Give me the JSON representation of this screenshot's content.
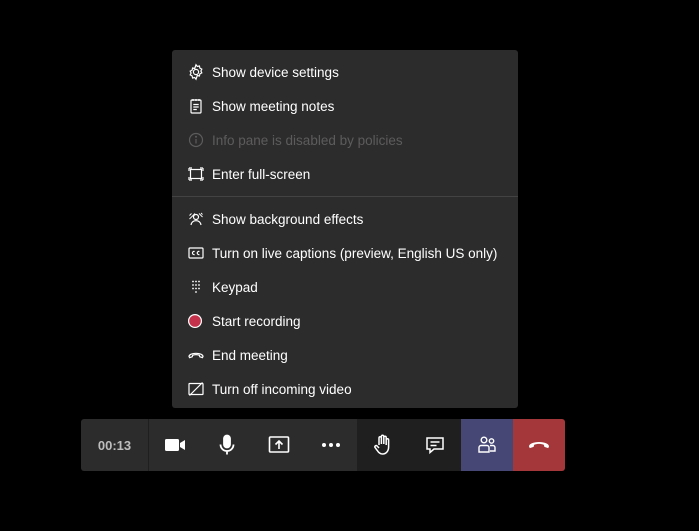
{
  "menu": {
    "items": [
      {
        "label": "Show device settings",
        "icon": "gear-icon",
        "disabled": false
      },
      {
        "label": "Show meeting notes",
        "icon": "notes-icon",
        "disabled": false
      },
      {
        "label": "Info pane is disabled by policies",
        "icon": "info-icon",
        "disabled": true
      },
      {
        "label": "Enter full-screen",
        "icon": "fullscreen-icon",
        "disabled": false
      },
      {
        "label": "Show background effects",
        "icon": "background-effects-icon",
        "disabled": false
      },
      {
        "label": "Turn on live captions (preview, English US only)",
        "icon": "captions-icon",
        "disabled": false
      },
      {
        "label": "Keypad",
        "icon": "keypad-icon",
        "disabled": false
      },
      {
        "label": "Start recording",
        "icon": "record-icon",
        "disabled": false
      },
      {
        "label": "End meeting",
        "icon": "end-call-icon",
        "disabled": false
      },
      {
        "label": "Turn off incoming video",
        "icon": "video-off-icon",
        "disabled": false
      }
    ]
  },
  "callbar": {
    "timer": "00:13",
    "buttons": [
      {
        "name": "camera-button",
        "icon": "camera-icon"
      },
      {
        "name": "microphone-button",
        "icon": "microphone-icon"
      },
      {
        "name": "share-screen-button",
        "icon": "share-screen-icon"
      },
      {
        "name": "more-actions-button",
        "icon": "more-icon"
      },
      {
        "name": "raise-hand-button",
        "icon": "hand-icon"
      },
      {
        "name": "chat-button",
        "icon": "chat-icon"
      },
      {
        "name": "participants-button",
        "icon": "participants-icon"
      },
      {
        "name": "hang-up-button",
        "icon": "hang-up-icon"
      }
    ]
  },
  "colors": {
    "menu_bg": "#2d2c2c",
    "control_bg": "#2d2c2c",
    "active_bg": "#464775",
    "hangup_bg": "#a4373a",
    "record_red": "#c4314b",
    "disabled_text": "#5d5c5c"
  }
}
